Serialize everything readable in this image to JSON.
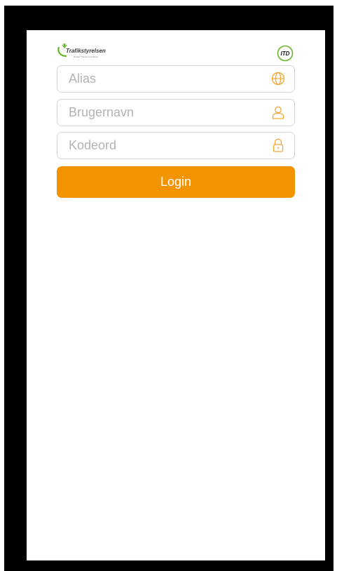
{
  "logos": {
    "left_name": "Trafikstyrelsen",
    "left_tagline": "Danish Transport Authority",
    "right_name": "ITD"
  },
  "form": {
    "alias": {
      "placeholder": "Alias",
      "icon": "globe-icon"
    },
    "username": {
      "placeholder": "Brugernavn",
      "icon": "user-icon"
    },
    "password": {
      "placeholder": "Kodeord",
      "icon": "lock-icon"
    },
    "login_label": "Login"
  },
  "colors": {
    "accent": "#f29400",
    "icon": "#f2a632",
    "placeholder": "#b3b3b3",
    "border": "#d5d5d5",
    "logo_green": "#6bb42a"
  }
}
